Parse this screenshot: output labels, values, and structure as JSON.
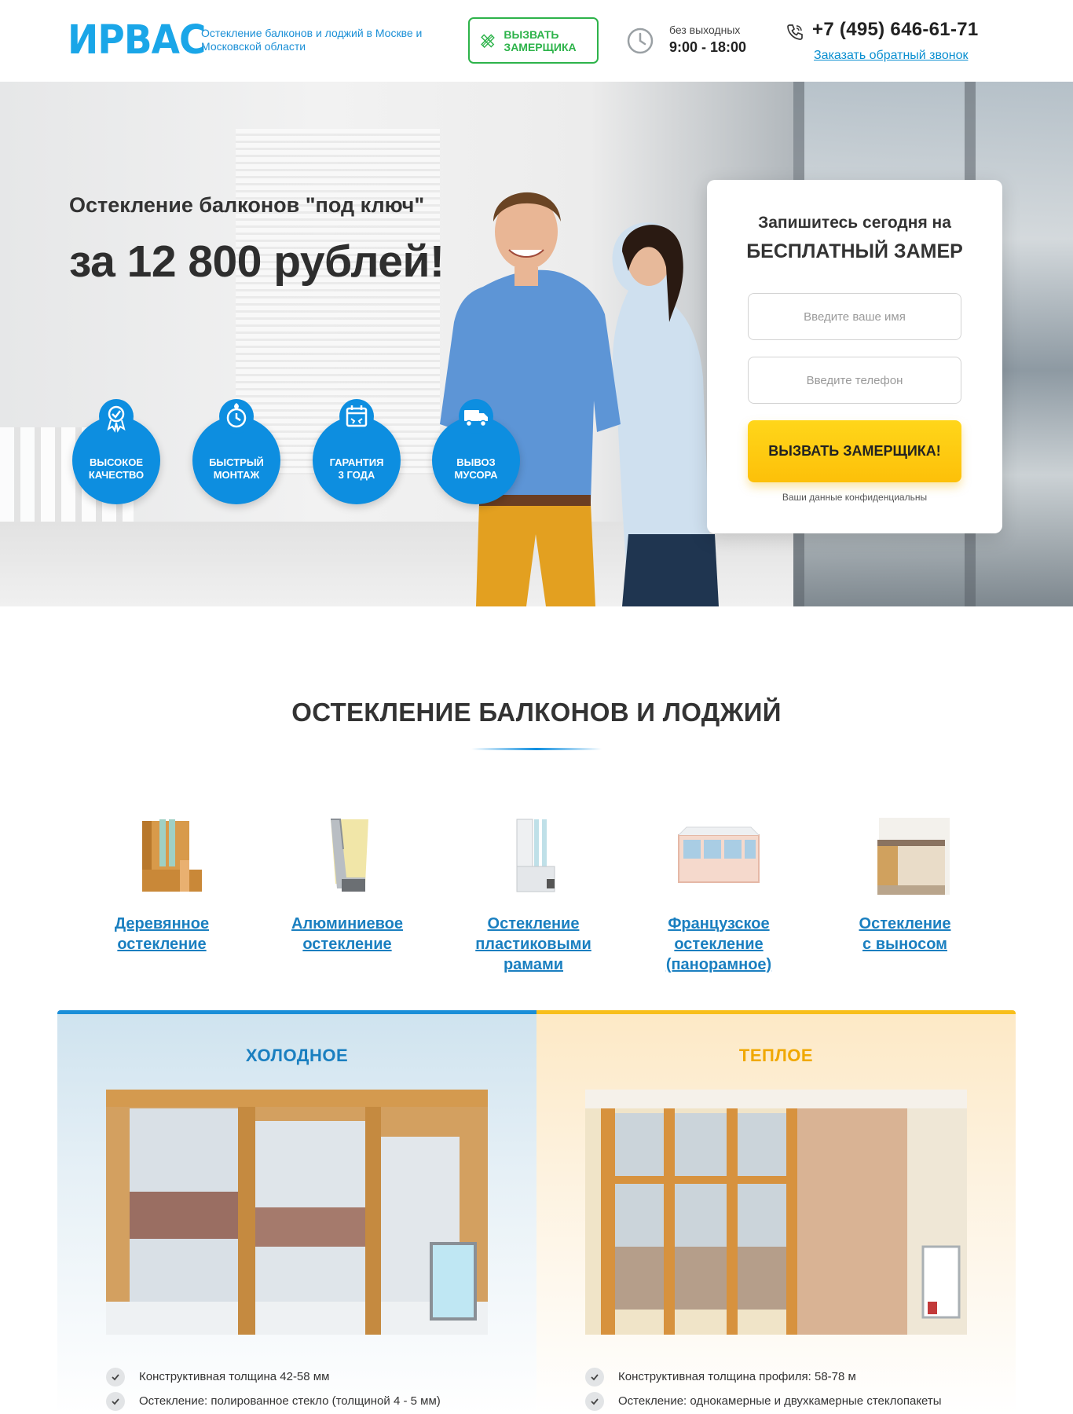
{
  "header": {
    "logo": "ИРВАС",
    "tagline": "Остекление балконов и лоджий в Москве и Московской области",
    "measure_button": "Вызвать замерщика",
    "hours_label": "без выходных",
    "hours_value": "9:00 - 18:00",
    "phone": "+7 (495) 646-61-71",
    "callback_link": "Заказать обратный звонок"
  },
  "hero": {
    "subtitle": "Остекление балконов \"под ключ\"",
    "title": "за 12 800 рублей!",
    "badges": [
      {
        "line1": "Высокое",
        "line2": "качество",
        "icon": "award-ribbon-icon"
      },
      {
        "line1": "Быстрый",
        "line2": "монтаж",
        "icon": "clock-icon"
      },
      {
        "line1": "Гарантия",
        "line2": "3 года",
        "icon": "calendar-icon"
      },
      {
        "line1": "Вывоз",
        "line2": "мусора",
        "icon": "truck-icon"
      }
    ]
  },
  "form": {
    "title_line1": "Запишитесь сегодня на",
    "title_line2": "бесплатный замер",
    "name_placeholder": "Введите ваше имя",
    "phone_placeholder": "Введите телефон",
    "submit": "Вызвать замерщика!",
    "note": "Ваши данные конфиденциальны"
  },
  "section": {
    "title": "Остекление балконов и лоджий",
    "categories": [
      {
        "line1": "Деревянное",
        "line2": "остекление",
        "line3": ""
      },
      {
        "line1": "Алюминиевое",
        "line2": "остекление",
        "line3": ""
      },
      {
        "line1": "Остекление",
        "line2": "пластиковыми",
        "line3": "рамами"
      },
      {
        "line1": "Французское",
        "line2": "остекление",
        "line3": "(панорамное)"
      },
      {
        "line1": "Остекление",
        "line2": "с выносом",
        "line3": ""
      }
    ]
  },
  "compare": {
    "cold": {
      "title": "Холодное",
      "features": [
        "Конструктивная толщина 42-58 мм",
        "Остекление: полированное стекло (толщиной 4 - 5 мм)"
      ]
    },
    "warm": {
      "title": "Теплое",
      "features": [
        "Конструктивная толщина профиля: 58-78 м",
        "Остекление: однокамерные и двухкамерные стеклопакеты"
      ]
    }
  },
  "colors": {
    "brand_blue": "#1aa6e8",
    "accent_green": "#2db34a",
    "accent_yellow": "#fdc009",
    "link_blue": "#1a7fc0"
  }
}
